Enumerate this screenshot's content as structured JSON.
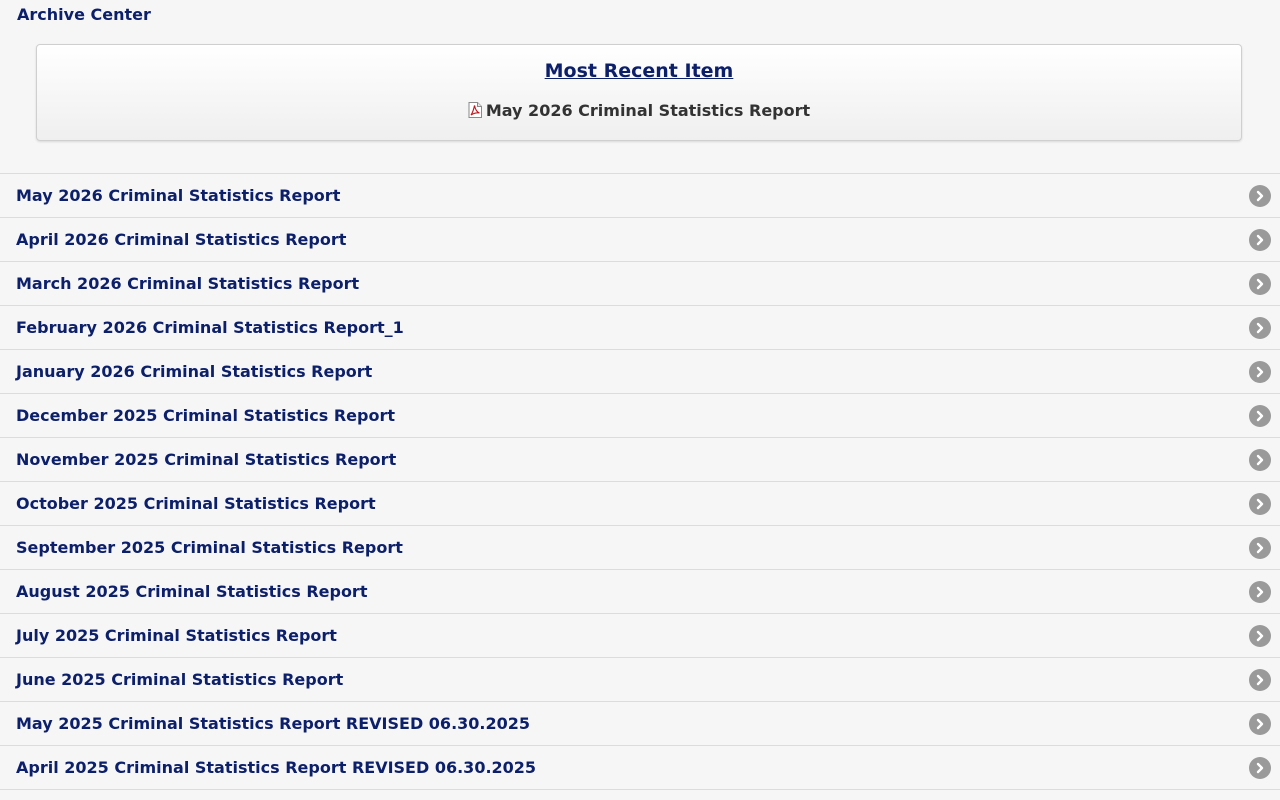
{
  "header": {
    "title": "Archive Center"
  },
  "most_recent": {
    "heading": "Most Recent Item",
    "item_label": "May 2026 Criminal Statistics Report",
    "item_icon": "pdf-icon"
  },
  "list": {
    "chevron_icon": "chevron-right-icon",
    "items": [
      {
        "label": "May 2026 Criminal Statistics Report"
      },
      {
        "label": "April 2026 Criminal Statistics Report"
      },
      {
        "label": "March 2026 Criminal Statistics Report"
      },
      {
        "label": "February 2026 Criminal Statistics Report_1"
      },
      {
        "label": "January 2026 Criminal Statistics Report"
      },
      {
        "label": "December 2025 Criminal Statistics Report"
      },
      {
        "label": "November 2025 Criminal Statistics Report"
      },
      {
        "label": "October 2025 Criminal Statistics Report"
      },
      {
        "label": "September 2025 Criminal Statistics Report"
      },
      {
        "label": "August 2025 Criminal Statistics Report"
      },
      {
        "label": "July 2025 Criminal Statistics Report"
      },
      {
        "label": "June 2025 Criminal Statistics Report"
      },
      {
        "label": "May 2025 Criminal Statistics Report REVISED 06.30.2025"
      },
      {
        "label": "April 2025 Criminal Statistics Report REVISED 06.30.2025"
      }
    ]
  },
  "colors": {
    "link": "#0c1f6b",
    "chevron_bg": "#9a9a9a",
    "pdf_red": "#c0141b"
  }
}
